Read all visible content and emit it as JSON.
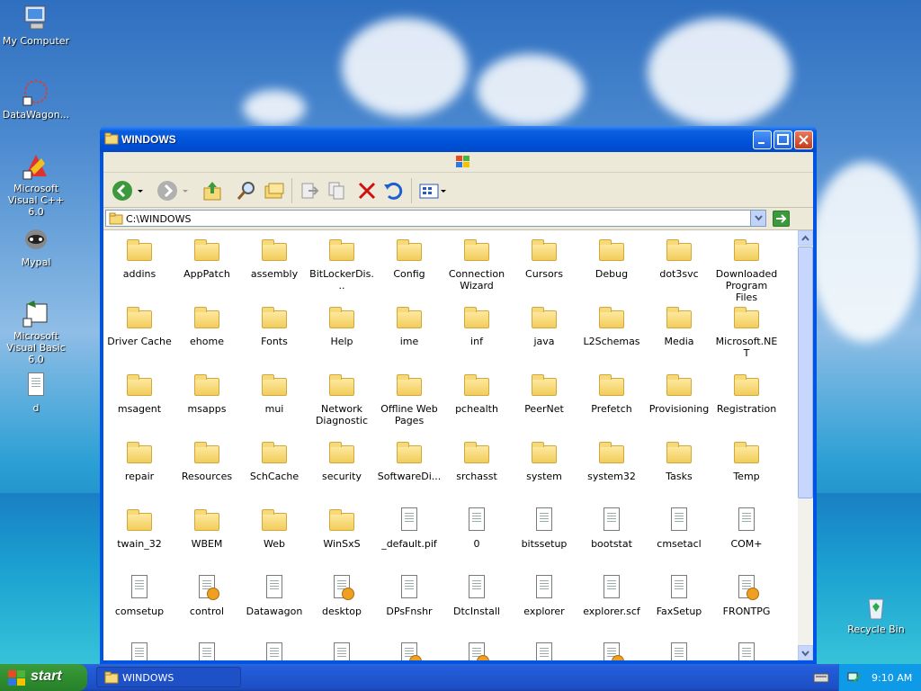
{
  "desktop": {
    "icons": [
      {
        "label": "My Computer"
      },
      {
        "label": "DataWagon..."
      },
      {
        "label": "Microsoft Visual C++ 6.0"
      },
      {
        "label": "Mypal"
      },
      {
        "label": "Microsoft Visual Basic 6.0"
      },
      {
        "label": "d"
      },
      {
        "label": "Recycle Bin"
      }
    ]
  },
  "window": {
    "title": "WINDOWS",
    "address": "C:\\WINDOWS",
    "toolbar": [
      "back-icon",
      "forward-icon",
      "up-folder-icon",
      "search-icon",
      "folders-icon",
      "move-to-icon",
      "copy-to-icon",
      "delete-icon",
      "undo-icon",
      "views-icon"
    ]
  },
  "items": [
    {
      "label": "addins",
      "icon": "folder"
    },
    {
      "label": "AppPatch",
      "icon": "folder"
    },
    {
      "label": "assembly",
      "icon": "folder"
    },
    {
      "label": "BitLockerDis...",
      "icon": "folder"
    },
    {
      "label": "Config",
      "icon": "folder"
    },
    {
      "label": "Connection Wizard",
      "icon": "folder"
    },
    {
      "label": "Cursors",
      "icon": "folder"
    },
    {
      "label": "Debug",
      "icon": "folder"
    },
    {
      "label": "dot3svc",
      "icon": "folder"
    },
    {
      "label": "Downloaded Program Files",
      "icon": "folder"
    },
    {
      "label": "Driver Cache",
      "icon": "folder"
    },
    {
      "label": "ehome",
      "icon": "folder"
    },
    {
      "label": "Fonts",
      "icon": "folder"
    },
    {
      "label": "Help",
      "icon": "folder"
    },
    {
      "label": "ime",
      "icon": "folder"
    },
    {
      "label": "inf",
      "icon": "folder"
    },
    {
      "label": "java",
      "icon": "folder"
    },
    {
      "label": "L2Schemas",
      "icon": "folder"
    },
    {
      "label": "Media",
      "icon": "folder"
    },
    {
      "label": "Microsoft.NET",
      "icon": "folder"
    },
    {
      "label": "msagent",
      "icon": "folder"
    },
    {
      "label": "msapps",
      "icon": "folder"
    },
    {
      "label": "mui",
      "icon": "folder"
    },
    {
      "label": "Network Diagnostic",
      "icon": "folder"
    },
    {
      "label": "Offline Web Pages",
      "icon": "folder"
    },
    {
      "label": "pchealth",
      "icon": "folder"
    },
    {
      "label": "PeerNet",
      "icon": "folder"
    },
    {
      "label": "Prefetch",
      "icon": "folder"
    },
    {
      "label": "Provisioning",
      "icon": "folder"
    },
    {
      "label": "Registration",
      "icon": "folder"
    },
    {
      "label": "repair",
      "icon": "folder"
    },
    {
      "label": "Resources",
      "icon": "folder"
    },
    {
      "label": "SchCache",
      "icon": "folder"
    },
    {
      "label": "security",
      "icon": "folder"
    },
    {
      "label": "SoftwareDi...",
      "icon": "folder"
    },
    {
      "label": "srchasst",
      "icon": "folder"
    },
    {
      "label": "system",
      "icon": "folder"
    },
    {
      "label": "system32",
      "icon": "folder"
    },
    {
      "label": "Tasks",
      "icon": "folder"
    },
    {
      "label": "Temp",
      "icon": "folder"
    },
    {
      "label": "twain_32",
      "icon": "folder"
    },
    {
      "label": "WBEM",
      "icon": "folder"
    },
    {
      "label": "Web",
      "icon": "folder"
    },
    {
      "label": "WinSxS",
      "icon": "folder"
    },
    {
      "label": "_default.pif",
      "icon": "doc"
    },
    {
      "label": "0",
      "icon": "doc"
    },
    {
      "label": "bitssetup",
      "icon": "doc"
    },
    {
      "label": "bootstat",
      "icon": "doc"
    },
    {
      "label": "cmsetacl",
      "icon": "doc"
    },
    {
      "label": "COM+",
      "icon": "doc"
    },
    {
      "label": "comsetup",
      "icon": "doc"
    },
    {
      "label": "control",
      "icon": "doc-gear"
    },
    {
      "label": "Datawagon",
      "icon": "doc"
    },
    {
      "label": "desktop",
      "icon": "doc-gear"
    },
    {
      "label": "DPsFnshr",
      "icon": "doc"
    },
    {
      "label": "DtcInstall",
      "icon": "doc"
    },
    {
      "label": "explorer",
      "icon": "doc"
    },
    {
      "label": "explorer.scf",
      "icon": "doc"
    },
    {
      "label": "FaxSetup",
      "icon": "doc"
    },
    {
      "label": "FRONTPG",
      "icon": "doc-gear"
    },
    {
      "label": "",
      "icon": "doc"
    },
    {
      "label": "",
      "icon": "doc"
    },
    {
      "label": "",
      "icon": "doc"
    },
    {
      "label": "",
      "icon": "doc"
    },
    {
      "label": "",
      "icon": "doc-gear"
    },
    {
      "label": "",
      "icon": "doc-gear"
    },
    {
      "label": "",
      "icon": "doc"
    },
    {
      "label": "",
      "icon": "doc-gear"
    },
    {
      "label": "",
      "icon": "doc"
    },
    {
      "label": "",
      "icon": "doc"
    }
  ],
  "taskbar": {
    "start_label": "start",
    "task_label": "WINDOWS",
    "clock": "9:10 AM"
  }
}
